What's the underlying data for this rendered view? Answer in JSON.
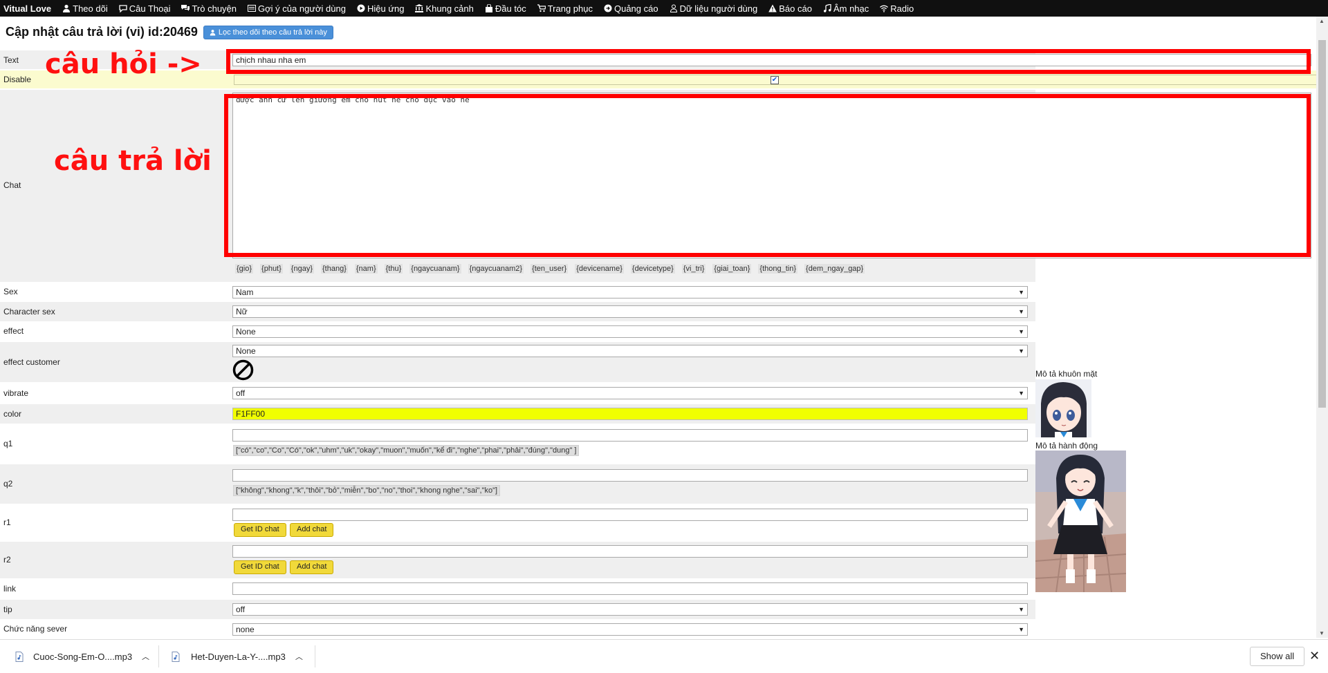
{
  "nav": {
    "brand": "Vitual Love",
    "items": [
      {
        "label": "Theo dõi",
        "icon": "user-icon"
      },
      {
        "label": "Câu Thoại",
        "icon": "comment-icon"
      },
      {
        "label": "Trò chuyện",
        "icon": "comments-icon"
      },
      {
        "label": "Gợi ý của người dùng",
        "icon": "list-icon"
      },
      {
        "label": "Hiệu ứng",
        "icon": "play-circle-icon"
      },
      {
        "label": "Khung cảnh",
        "icon": "bank-icon"
      },
      {
        "label": "Đầu tóc",
        "icon": "shopping-bag-icon"
      },
      {
        "label": "Trang phục",
        "icon": "cart-icon"
      },
      {
        "label": "Quảng cáo",
        "icon": "arrow-circle-icon"
      },
      {
        "label": "Dữ liệu người dùng",
        "icon": "user-outline-icon"
      },
      {
        "label": "Báo cáo",
        "icon": "warning-icon"
      },
      {
        "label": "Âm nhạc",
        "icon": "music-icon"
      },
      {
        "label": "Radio",
        "icon": "wifi-icon"
      }
    ]
  },
  "header": {
    "title": "Cập nhật câu trả lời (vi) id:20469",
    "filter_button": "Lọc theo dõi theo câu trả lời này"
  },
  "form": {
    "text": {
      "label": "Text",
      "value": "chịch nhau nha em"
    },
    "disable": {
      "label": "Disable",
      "checked": true
    },
    "chat": {
      "label": "Chat",
      "value": "được anh cứ lên giường em cho nút nè cho dục vào nè"
    },
    "tags": [
      "{gio}",
      "{phut}",
      "{ngay}",
      "{thang}",
      "{nam}",
      "{thu}",
      "{ngaycuanam}",
      "{ngaycuanam2}",
      "{ten_user}",
      "{devicename}",
      "{devicetype}",
      "{vi_tri}",
      "{giai_toan}",
      "{thong_tin}",
      "{dem_ngay_gap}"
    ],
    "sex": {
      "label": "Sex",
      "value": "Nam"
    },
    "character_sex": {
      "label": "Character sex",
      "value": "Nữ"
    },
    "effect": {
      "label": "effect",
      "value": "None"
    },
    "effect_customer": {
      "label": "effect customer",
      "value": "None"
    },
    "vibrate": {
      "label": "vibrate",
      "value": "off"
    },
    "color": {
      "label": "color",
      "value": "F1FF00",
      "hex": "#F1FF00"
    },
    "q1": {
      "label": "q1",
      "value": "",
      "hint": "[\"có\",\"co\",\"Co\",\"Có\",\"ok\",\"uhm\",\"uk\",\"okay\",\"muon\",\"muốn\",\"kể đi\",\"nghe\",\"phai\",\"phải\",\"đúng\",\"dung\" ]"
    },
    "q2": {
      "label": "q2",
      "value": "",
      "hint": "[\"không\",\"khong\",\"k\",\"thôi\",\"bỏ\",\"miễn\",\"bo\",\"no\",\"thoi\",\"khong nghe\",\"sai\",\"ko\"]"
    },
    "r1": {
      "label": "r1",
      "value": "",
      "btn_get": "Get ID chat",
      "btn_add": "Add chat"
    },
    "r2": {
      "label": "r2",
      "value": "",
      "btn_get": "Get ID chat",
      "btn_add": "Add chat"
    },
    "link": {
      "label": "link",
      "value": ""
    },
    "tip": {
      "label": "tip",
      "value": "off"
    },
    "server": {
      "label": "Chức năng sever",
      "value": "none"
    }
  },
  "annotations": {
    "question": "câu hỏi ->",
    "answer": "câu trả lời"
  },
  "previews": {
    "face_label": "Mô tả khuôn mặt",
    "action_label": "Mô tả hành động"
  },
  "downloads": {
    "items": [
      "Cuoc-Song-Em-O....mp3",
      "Het-Duyen-La-Y-....mp3"
    ],
    "show_all": "Show all"
  },
  "colors": {
    "nav_bg": "#101010",
    "accent_red": "#ff0000",
    "button_yellow": "#f1d93a",
    "filter_blue": "#4a90d9"
  }
}
